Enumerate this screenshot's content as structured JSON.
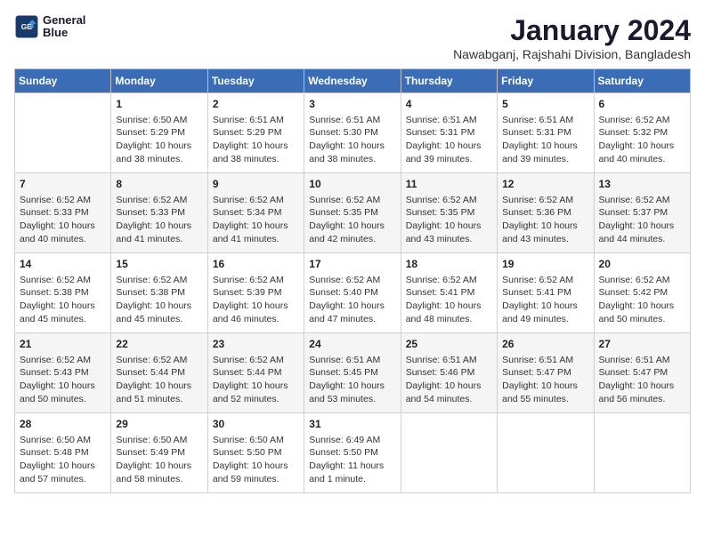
{
  "header": {
    "title": "January 2024",
    "subtitle": "Nawabganj, Rajshahi Division, Bangladesh",
    "logo_line1": "General",
    "logo_line2": "Blue"
  },
  "days_of_week": [
    "Sunday",
    "Monday",
    "Tuesday",
    "Wednesday",
    "Thursday",
    "Friday",
    "Saturday"
  ],
  "weeks": [
    [
      {
        "num": "",
        "text": ""
      },
      {
        "num": "1",
        "text": "Sunrise: 6:50 AM\nSunset: 5:29 PM\nDaylight: 10 hours\nand 38 minutes."
      },
      {
        "num": "2",
        "text": "Sunrise: 6:51 AM\nSunset: 5:29 PM\nDaylight: 10 hours\nand 38 minutes."
      },
      {
        "num": "3",
        "text": "Sunrise: 6:51 AM\nSunset: 5:30 PM\nDaylight: 10 hours\nand 38 minutes."
      },
      {
        "num": "4",
        "text": "Sunrise: 6:51 AM\nSunset: 5:31 PM\nDaylight: 10 hours\nand 39 minutes."
      },
      {
        "num": "5",
        "text": "Sunrise: 6:51 AM\nSunset: 5:31 PM\nDaylight: 10 hours\nand 39 minutes."
      },
      {
        "num": "6",
        "text": "Sunrise: 6:52 AM\nSunset: 5:32 PM\nDaylight: 10 hours\nand 40 minutes."
      }
    ],
    [
      {
        "num": "7",
        "text": "Sunrise: 6:52 AM\nSunset: 5:33 PM\nDaylight: 10 hours\nand 40 minutes."
      },
      {
        "num": "8",
        "text": "Sunrise: 6:52 AM\nSunset: 5:33 PM\nDaylight: 10 hours\nand 41 minutes."
      },
      {
        "num": "9",
        "text": "Sunrise: 6:52 AM\nSunset: 5:34 PM\nDaylight: 10 hours\nand 41 minutes."
      },
      {
        "num": "10",
        "text": "Sunrise: 6:52 AM\nSunset: 5:35 PM\nDaylight: 10 hours\nand 42 minutes."
      },
      {
        "num": "11",
        "text": "Sunrise: 6:52 AM\nSunset: 5:35 PM\nDaylight: 10 hours\nand 43 minutes."
      },
      {
        "num": "12",
        "text": "Sunrise: 6:52 AM\nSunset: 5:36 PM\nDaylight: 10 hours\nand 43 minutes."
      },
      {
        "num": "13",
        "text": "Sunrise: 6:52 AM\nSunset: 5:37 PM\nDaylight: 10 hours\nand 44 minutes."
      }
    ],
    [
      {
        "num": "14",
        "text": "Sunrise: 6:52 AM\nSunset: 5:38 PM\nDaylight: 10 hours\nand 45 minutes."
      },
      {
        "num": "15",
        "text": "Sunrise: 6:52 AM\nSunset: 5:38 PM\nDaylight: 10 hours\nand 45 minutes."
      },
      {
        "num": "16",
        "text": "Sunrise: 6:52 AM\nSunset: 5:39 PM\nDaylight: 10 hours\nand 46 minutes."
      },
      {
        "num": "17",
        "text": "Sunrise: 6:52 AM\nSunset: 5:40 PM\nDaylight: 10 hours\nand 47 minutes."
      },
      {
        "num": "18",
        "text": "Sunrise: 6:52 AM\nSunset: 5:41 PM\nDaylight: 10 hours\nand 48 minutes."
      },
      {
        "num": "19",
        "text": "Sunrise: 6:52 AM\nSunset: 5:41 PM\nDaylight: 10 hours\nand 49 minutes."
      },
      {
        "num": "20",
        "text": "Sunrise: 6:52 AM\nSunset: 5:42 PM\nDaylight: 10 hours\nand 50 minutes."
      }
    ],
    [
      {
        "num": "21",
        "text": "Sunrise: 6:52 AM\nSunset: 5:43 PM\nDaylight: 10 hours\nand 50 minutes."
      },
      {
        "num": "22",
        "text": "Sunrise: 6:52 AM\nSunset: 5:44 PM\nDaylight: 10 hours\nand 51 minutes."
      },
      {
        "num": "23",
        "text": "Sunrise: 6:52 AM\nSunset: 5:44 PM\nDaylight: 10 hours\nand 52 minutes."
      },
      {
        "num": "24",
        "text": "Sunrise: 6:51 AM\nSunset: 5:45 PM\nDaylight: 10 hours\nand 53 minutes."
      },
      {
        "num": "25",
        "text": "Sunrise: 6:51 AM\nSunset: 5:46 PM\nDaylight: 10 hours\nand 54 minutes."
      },
      {
        "num": "26",
        "text": "Sunrise: 6:51 AM\nSunset: 5:47 PM\nDaylight: 10 hours\nand 55 minutes."
      },
      {
        "num": "27",
        "text": "Sunrise: 6:51 AM\nSunset: 5:47 PM\nDaylight: 10 hours\nand 56 minutes."
      }
    ],
    [
      {
        "num": "28",
        "text": "Sunrise: 6:50 AM\nSunset: 5:48 PM\nDaylight: 10 hours\nand 57 minutes."
      },
      {
        "num": "29",
        "text": "Sunrise: 6:50 AM\nSunset: 5:49 PM\nDaylight: 10 hours\nand 58 minutes."
      },
      {
        "num": "30",
        "text": "Sunrise: 6:50 AM\nSunset: 5:50 PM\nDaylight: 10 hours\nand 59 minutes."
      },
      {
        "num": "31",
        "text": "Sunrise: 6:49 AM\nSunset: 5:50 PM\nDaylight: 11 hours\nand 1 minute."
      },
      {
        "num": "",
        "text": ""
      },
      {
        "num": "",
        "text": ""
      },
      {
        "num": "",
        "text": ""
      }
    ]
  ]
}
